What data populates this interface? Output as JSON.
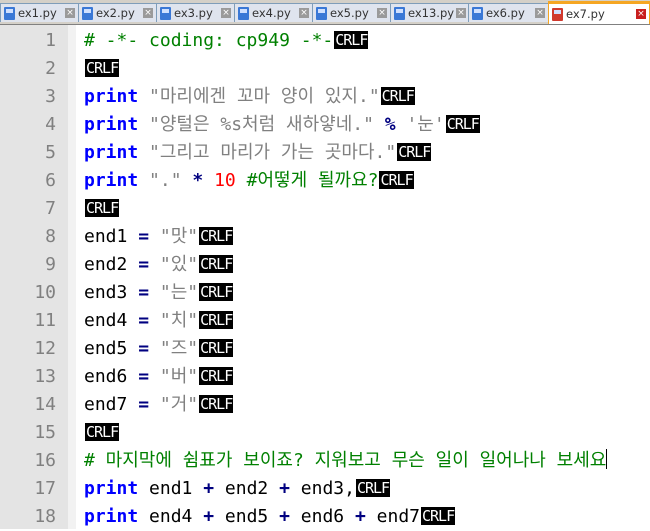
{
  "tabs": [
    {
      "label": "ex1.py",
      "active": false,
      "unsaved": false
    },
    {
      "label": "ex2.py",
      "active": false,
      "unsaved": false
    },
    {
      "label": "ex3.py",
      "active": false,
      "unsaved": false
    },
    {
      "label": "ex4.py",
      "active": false,
      "unsaved": false
    },
    {
      "label": "ex5.py",
      "active": false,
      "unsaved": false
    },
    {
      "label": "ex13.py",
      "active": false,
      "unsaved": false
    },
    {
      "label": "ex6.py",
      "active": false,
      "unsaved": false
    },
    {
      "label": "ex7.py",
      "active": true,
      "unsaved": true
    }
  ],
  "icons": {
    "file": "save-file-icon",
    "close": "close-tab-icon"
  },
  "eol_marker": "CRLF",
  "colors": {
    "keyword": "#0000ff",
    "string": "#808080",
    "number": "#ff0000",
    "operator": "#000080",
    "comment": "#008000",
    "active_tab_border": "#f5a623"
  },
  "lines": [
    {
      "n": "1",
      "tokens": [
        {
          "t": "cm",
          "v": "# -*- coding: cp949 -*-"
        }
      ],
      "eol": true
    },
    {
      "n": "2",
      "tokens": [],
      "eol": true
    },
    {
      "n": "3",
      "tokens": [
        {
          "t": "kw",
          "v": "print"
        },
        {
          "t": "p",
          "v": " "
        },
        {
          "t": "str",
          "v": "\"마리에겐 꼬마 양이 있지.\""
        }
      ],
      "eol": true
    },
    {
      "n": "4",
      "tokens": [
        {
          "t": "kw",
          "v": "print"
        },
        {
          "t": "p",
          "v": " "
        },
        {
          "t": "str",
          "v": "\"양털은 %s처럼 새하얗네.\""
        },
        {
          "t": "p",
          "v": " "
        },
        {
          "t": "op",
          "v": "%"
        },
        {
          "t": "p",
          "v": " "
        },
        {
          "t": "str",
          "v": "'눈'"
        }
      ],
      "eol": true
    },
    {
      "n": "5",
      "tokens": [
        {
          "t": "kw",
          "v": "print"
        },
        {
          "t": "p",
          "v": " "
        },
        {
          "t": "str",
          "v": "\"그리고 마리가 가는 곳마다.\""
        }
      ],
      "eol": true
    },
    {
      "n": "6",
      "tokens": [
        {
          "t": "kw",
          "v": "print"
        },
        {
          "t": "p",
          "v": " "
        },
        {
          "t": "str",
          "v": "\".\""
        },
        {
          "t": "p",
          "v": " "
        },
        {
          "t": "op",
          "v": "*"
        },
        {
          "t": "p",
          "v": " "
        },
        {
          "t": "num",
          "v": "10"
        },
        {
          "t": "p",
          "v": " "
        },
        {
          "t": "cm",
          "v": "#어떻게 될까요?"
        }
      ],
      "eol": true
    },
    {
      "n": "7",
      "tokens": [],
      "eol": true
    },
    {
      "n": "8",
      "tokens": [
        {
          "t": "p",
          "v": "end1 "
        },
        {
          "t": "op",
          "v": "="
        },
        {
          "t": "p",
          "v": " "
        },
        {
          "t": "str",
          "v": "\"맛\""
        }
      ],
      "eol": true
    },
    {
      "n": "9",
      "tokens": [
        {
          "t": "p",
          "v": "end2 "
        },
        {
          "t": "op",
          "v": "="
        },
        {
          "t": "p",
          "v": " "
        },
        {
          "t": "str",
          "v": "\"있\""
        }
      ],
      "eol": true
    },
    {
      "n": "10",
      "tokens": [
        {
          "t": "p",
          "v": "end3 "
        },
        {
          "t": "op",
          "v": "="
        },
        {
          "t": "p",
          "v": " "
        },
        {
          "t": "str",
          "v": "\"는\""
        }
      ],
      "eol": true
    },
    {
      "n": "11",
      "tokens": [
        {
          "t": "p",
          "v": "end4 "
        },
        {
          "t": "op",
          "v": "="
        },
        {
          "t": "p",
          "v": " "
        },
        {
          "t": "str",
          "v": "\"치\""
        }
      ],
      "eol": true
    },
    {
      "n": "12",
      "tokens": [
        {
          "t": "p",
          "v": "end5 "
        },
        {
          "t": "op",
          "v": "="
        },
        {
          "t": "p",
          "v": " "
        },
        {
          "t": "str",
          "v": "\"즈\""
        }
      ],
      "eol": true
    },
    {
      "n": "13",
      "tokens": [
        {
          "t": "p",
          "v": "end6 "
        },
        {
          "t": "op",
          "v": "="
        },
        {
          "t": "p",
          "v": " "
        },
        {
          "t": "str",
          "v": "\"버\""
        }
      ],
      "eol": true
    },
    {
      "n": "14",
      "tokens": [
        {
          "t": "p",
          "v": "end7 "
        },
        {
          "t": "op",
          "v": "="
        },
        {
          "t": "p",
          "v": " "
        },
        {
          "t": "str",
          "v": "\"거\""
        }
      ],
      "eol": true
    },
    {
      "n": "15",
      "tokens": [],
      "eol": true
    },
    {
      "n": "16",
      "tokens": [
        {
          "t": "cm",
          "v": "# 마지막에 쉼표가 보이죠? 지워보고 무슨 일이 일어나나 보세요"
        }
      ],
      "eol": false,
      "caret": true
    },
    {
      "n": "17",
      "tokens": [
        {
          "t": "kw",
          "v": "print"
        },
        {
          "t": "p",
          "v": " end1 "
        },
        {
          "t": "op",
          "v": "+"
        },
        {
          "t": "p",
          "v": " end2 "
        },
        {
          "t": "op",
          "v": "+"
        },
        {
          "t": "p",
          "v": " end3,"
        }
      ],
      "eol": true
    },
    {
      "n": "18",
      "tokens": [
        {
          "t": "kw",
          "v": "print"
        },
        {
          "t": "p",
          "v": " end4 "
        },
        {
          "t": "op",
          "v": "+"
        },
        {
          "t": "p",
          "v": " end5 "
        },
        {
          "t": "op",
          "v": "+"
        },
        {
          "t": "p",
          "v": " end6 "
        },
        {
          "t": "op",
          "v": "+"
        },
        {
          "t": "p",
          "v": " end7"
        }
      ],
      "eol": true
    }
  ]
}
